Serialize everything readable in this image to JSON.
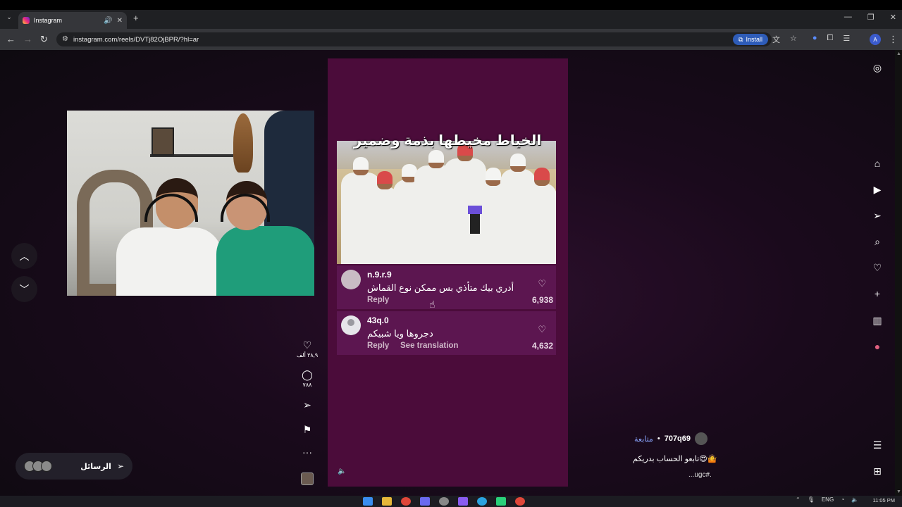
{
  "browser": {
    "tab_title": "Instagram",
    "url": "instagram.com/reels/DVTj82OjBPR/?hl=ar",
    "install_label": "Install",
    "profile_initial": "A"
  },
  "reel": {
    "caption": "الخياط مخيطها بذمة وضمير",
    "comments": [
      {
        "user": "n.9.r.9",
        "text": "أدري بيك متأذي بس ممكن نوع القماش",
        "reply": "Reply",
        "likes": "6,938"
      },
      {
        "user": "43q.0",
        "text": "دجروها ويا شبيكم",
        "reply": "Reply",
        "translation": "See translation",
        "likes": "4,632"
      }
    ]
  },
  "actions": {
    "likes": "٣٨,٩ ألف",
    "comments": "٧٨٨"
  },
  "messages": {
    "label": "الرسائل"
  },
  "author": {
    "username": "707q69",
    "follow_label": "متابعة",
    "separator": "•",
    "description": "تابعو الحساب بدريكم😍🤷",
    "hashtag": "...ugc#."
  },
  "clock": {
    "time": "11:05 PM"
  },
  "tray": {
    "language": "ENG"
  },
  "icons": [
    "instagram-icon",
    "home-icon",
    "reels-icon",
    "send-icon",
    "search-icon",
    "heart-icon",
    "plus-icon",
    "insights-icon",
    "menu-icon",
    "apps-icon"
  ]
}
